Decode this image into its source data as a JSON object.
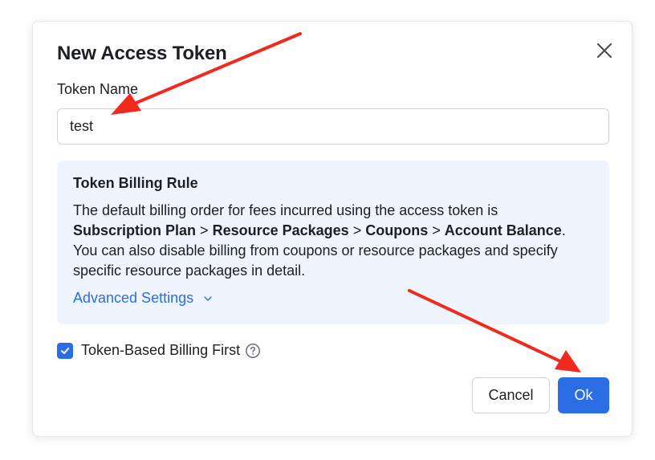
{
  "dialog": {
    "title": "New Access Token",
    "close_icon": "close-icon"
  },
  "token_name": {
    "label": "Token Name",
    "value": "test"
  },
  "billing_rule": {
    "title": "Token Billing Rule",
    "text_intro": "The default billing order for fees incurred using the access token is",
    "order": [
      "Subscription Plan",
      "Resource Packages",
      "Coupons",
      "Account Balance"
    ],
    "separator": ">",
    "text_outro": "You can also disable billing from coupons or resource packages and specify specific resource packages in detail.",
    "advanced_label": "Advanced Settings",
    "advanced_icon": "chevron-down-icon"
  },
  "checkbox": {
    "label": "Token-Based Billing First",
    "checked": true,
    "help_icon": "question-circle-icon"
  },
  "buttons": {
    "cancel": "Cancel",
    "ok": "Ok"
  },
  "colors": {
    "accent": "#2b6de5",
    "rule_bg": "#eff5ff",
    "annotation_arrow": "#f02a1f"
  }
}
